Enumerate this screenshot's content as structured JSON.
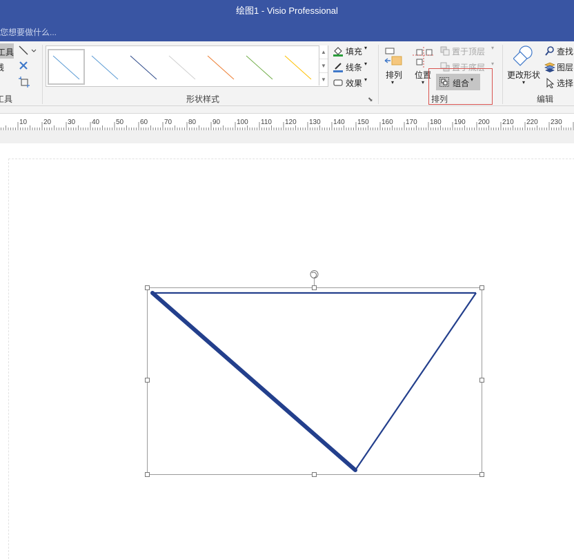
{
  "window": {
    "title": "绘图1 - Visio Professional"
  },
  "tell_me": {
    "placeholder": "您想要做什么..."
  },
  "ribbon": {
    "tools_group": {
      "selected_tool_label": "工具",
      "connector_label": "线",
      "group_label": "工具"
    },
    "shape_styles": {
      "label": "形状样式",
      "swatch_colors": [
        "#5b9bd5",
        "#5b9bd5",
        "#2e4a8a",
        "#d0d0d0",
        "#ed7d31",
        "#70ad47",
        "#ffc000"
      ],
      "fill_label": "填充",
      "line_label": "线条",
      "effects_label": "效果"
    },
    "arrange": {
      "label": "排列",
      "align_label": "排列",
      "position_label": "位置",
      "bring_front_label": "置于顶层",
      "send_back_label": "置于底层",
      "group_label": "组合"
    },
    "editing": {
      "label": "编辑",
      "change_shape_label": "更改形状",
      "find_label": "查找",
      "layers_label": "图层",
      "select_label": "选择"
    }
  },
  "ruler": {
    "labels": [
      "10",
      "20",
      "30",
      "40",
      "50",
      "60",
      "70",
      "80",
      "90",
      "100",
      "110",
      "120",
      "130",
      "140",
      "150",
      "160",
      "170",
      "180",
      "190",
      "200",
      "210",
      "220",
      "230"
    ]
  },
  "canvas": {
    "shape_color": "#233f8c"
  }
}
